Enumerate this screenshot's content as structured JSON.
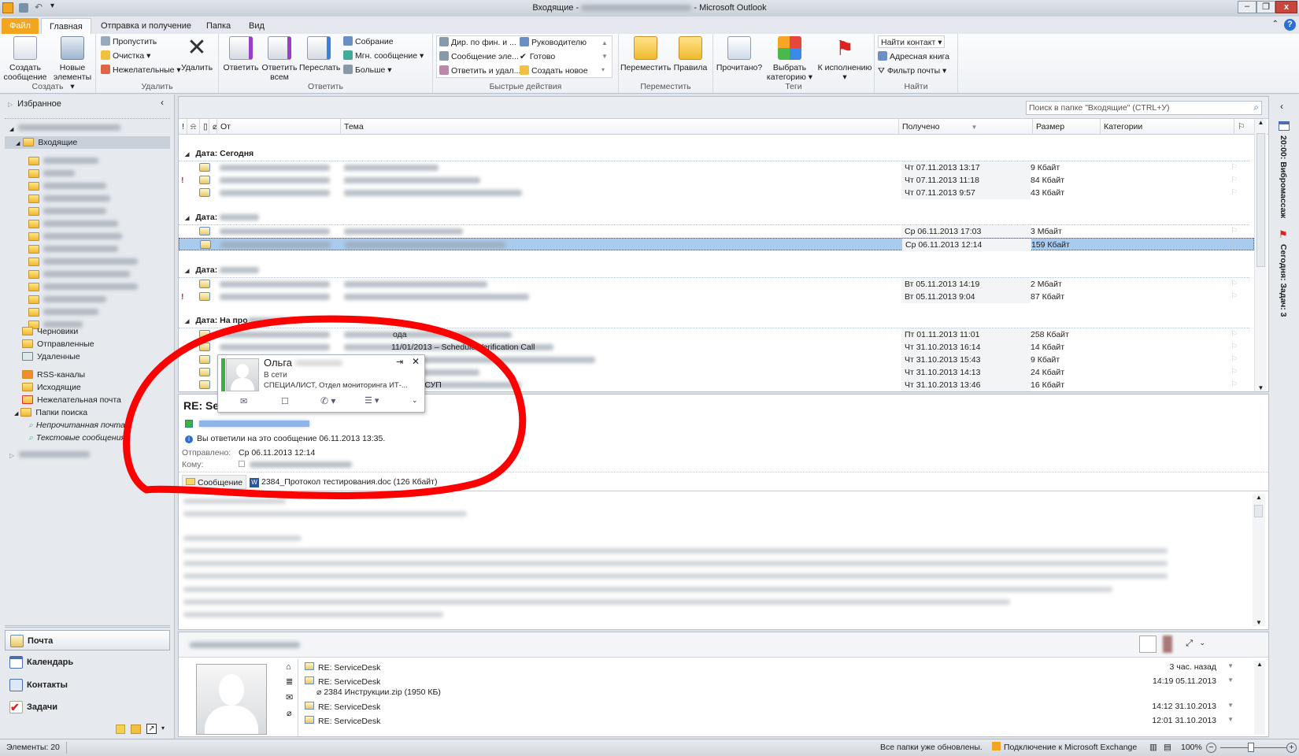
{
  "window": {
    "title": "Входящие - ",
    "app": "Microsoft Outlook"
  },
  "tabs": [
    "Файл",
    "Главная",
    "Отправка и получение",
    "Папка",
    "Вид"
  ],
  "ribbon": {
    "create": {
      "label": "Создать",
      "new_message": "Создать сообщение",
      "new_items": "Новые элементы ▾"
    },
    "delete": {
      "label": "Удалить",
      "ignore": "Пропустить",
      "cleanup": "Очистка ▾",
      "junk": "Нежелательные ▾",
      "delete": "Удалить"
    },
    "respond": {
      "label": "Ответить",
      "reply": "Ответить",
      "reply_all": "Ответить всем",
      "forward": "Переслать",
      "meeting": "Собрание",
      "im": "Мгн. сообщение ▾",
      "more": "Больше ▾"
    },
    "quick": {
      "label": "Быстрые действия",
      "items": [
        "Дир. по фин. и ...",
        "Руководителю",
        "Сообщение эле...",
        "Готово",
        "Ответить и удал...",
        "Создать новое"
      ]
    },
    "move": {
      "label": "Переместить",
      "move": "Переместить",
      "rules": "Правила"
    },
    "tags": {
      "label": "Теги",
      "read": "Прочитано?",
      "categorize": "Выбрать категорию ▾",
      "followup": "К исполнению ▾"
    },
    "find": {
      "label": "Найти",
      "find_contact": "Найти контакт ▾",
      "address_book": "Адресная книга",
      "filter": "Фильтр почты ▾"
    }
  },
  "nav": {
    "favorites": "Избранное",
    "inbox": "Входящие",
    "folders": [
      "Черновики",
      "Отправленные",
      "Удаленные",
      "RSS-каналы",
      "Исходящие",
      "Нежелательная почта",
      "Папки поиска",
      "Непрочитанная почта",
      "Текстовые сообщения"
    ],
    "buttons": [
      "Почта",
      "Календарь",
      "Контакты",
      "Задачи"
    ]
  },
  "list": {
    "search_placeholder": "Поиск в папке \"Входящие\" (CTRL+У)",
    "columns": {
      "from": "От",
      "subject": "Тема",
      "received": "Получено",
      "size": "Размер",
      "categories": "Категории"
    },
    "groups": [
      {
        "label": "Дата: Сегодня",
        "rows": [
          {
            "received": "Чт 07.11.2013 13:17",
            "size": "9 Кбайт"
          },
          {
            "received": "Чт 07.11.2013 11:18",
            "size": "84 Кбайт",
            "important": true
          },
          {
            "received": "Чт 07.11.2013 9:57",
            "size": "43 Кбайт"
          }
        ]
      },
      {
        "label": "Дата: ",
        "rows": [
          {
            "received": "Ср 06.11.2013 17:03",
            "size": "3 Мбайт"
          },
          {
            "received": "Ср 06.11.2013 12:14",
            "size": "159 Кбайт",
            "selected": true
          }
        ]
      },
      {
        "label": "Дата: ",
        "rows": [
          {
            "received": "Вт 05.11.2013 14:19",
            "size": "2 Мбайт"
          },
          {
            "received": "Вт 05.11.2013 9:04",
            "size": "87 Кбайт",
            "important": true
          }
        ]
      },
      {
        "label": "Дата: На про",
        "rows": [
          {
            "received": "Пт 01.11.2013 11:01",
            "size": "258 Кбайт",
            "subject": "ода"
          },
          {
            "received": "Чт 31.10.2013 16:14",
            "size": "14 Кбайт",
            "subject": "11/01/2013 – Schedule Verification Call"
          },
          {
            "received": "Чт 31.10.2013 15:43",
            "size": "9 Кбайт"
          },
          {
            "received": "Чт 31.10.2013 14:13",
            "size": "24 Кбайт"
          },
          {
            "received": "Чт 31.10.2013 13:46",
            "size": "16 Кбайт",
            "subject": "жбы АСУП"
          }
        ]
      }
    ]
  },
  "contact_card": {
    "name": "Ольга",
    "status": "В сети",
    "title": "СПЕЦИАЛИСТ, Отдел мониторинга ИТ-..."
  },
  "reading": {
    "subject": "RE: Se",
    "info": "Вы ответили на это сообщение 06.11.2013 13:35.",
    "sent_label": "Отправлено:",
    "sent": "Ср 06.11.2013 12:14",
    "to_label": "Кому:",
    "message_tab": "Сообщение",
    "attachment": "2384_Протокол тестирования.doc (126 Кбайт)"
  },
  "people": {
    "items": [
      {
        "title": "RE: ServiceDesk",
        "time": "3 час. назад"
      },
      {
        "title": "RE: ServiceDesk",
        "time": "14:19  05.11.2013",
        "attachment": "2384 Инструкции.zip (1950 КБ)"
      },
      {
        "title": "RE: ServiceDesk",
        "time": "14:12  31.10.2013"
      },
      {
        "title": "RE: ServiceDesk",
        "time": "12:01  31.10.2013"
      }
    ]
  },
  "todo": {
    "appointment": "20:00: Вибромассаж",
    "tasks": "Сегодня: Задач: 3"
  },
  "status": {
    "items": "Элементы: 20",
    "updated": "Все папки уже обновлены.",
    "connection": "Подключение к Microsoft Exchange",
    "zoom": "100%"
  },
  "colors": {
    "accent": "#f2a51f",
    "selection": "#a9cbee",
    "annotation": "#ff0000"
  }
}
